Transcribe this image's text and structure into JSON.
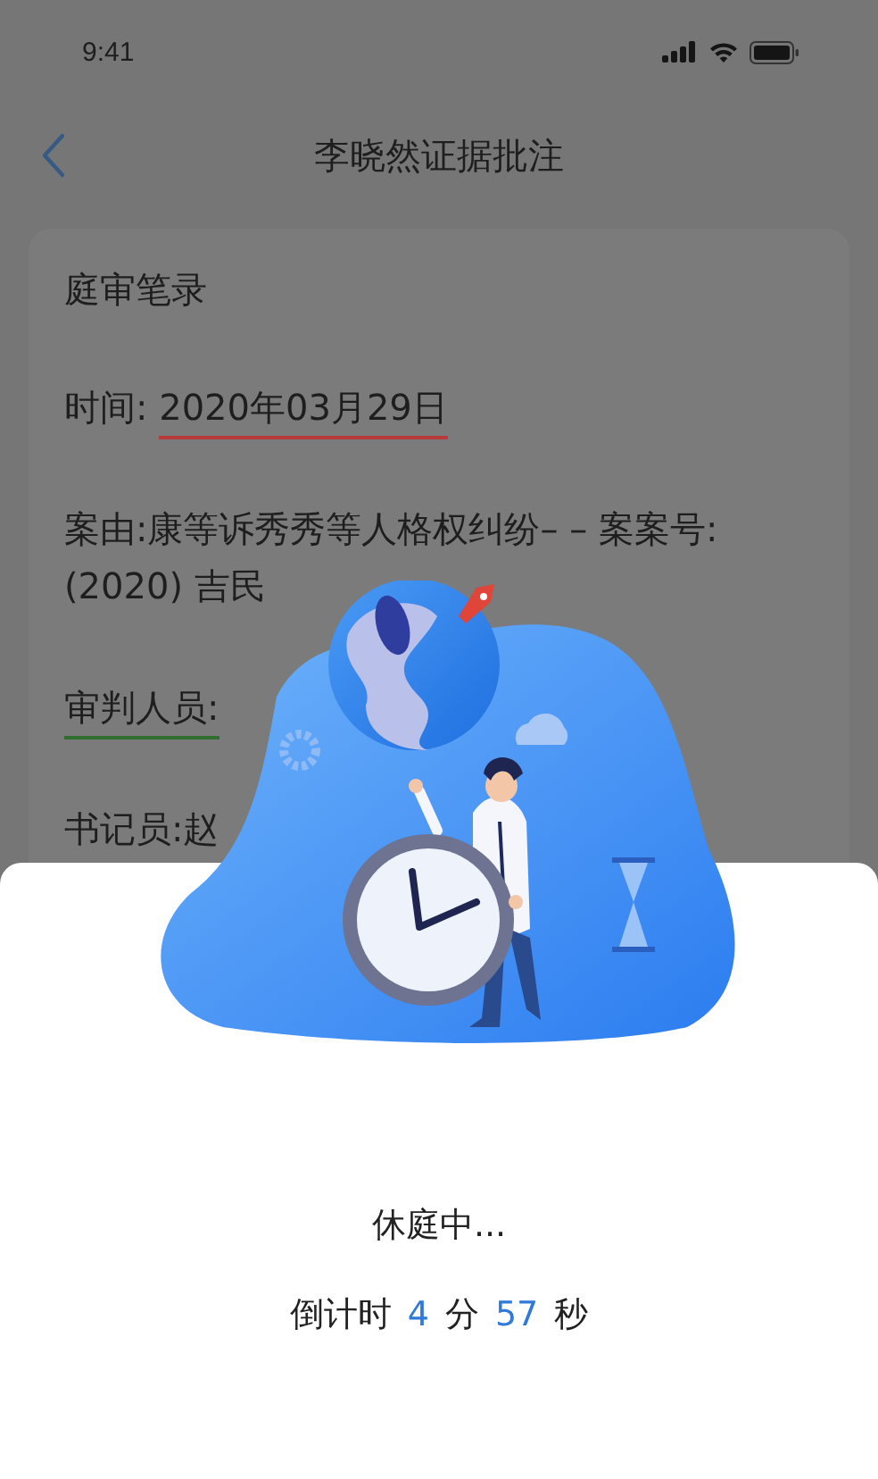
{
  "status_bar": {
    "time": "9:41"
  },
  "nav": {
    "title": "李晓然证据批注"
  },
  "record": {
    "lines": [
      {
        "text": "庭审笔录"
      },
      {
        "text": "时间: ",
        "marked": {
          "text": "2020年03月29日",
          "color": "#b83a3a"
        }
      },
      {
        "text": "案由:康等诉秀秀等人格权纠纷– – 案案号: (2020) 吉民"
      },
      {
        "marked": {
          "text": "审判人员:",
          "color": "#2f6e2f"
        }
      },
      {
        "text": "书记员:赵"
      }
    ]
  },
  "sheet": {
    "status": "休庭中...",
    "countdown": [
      {
        "text": "倒计时",
        "kind": "label"
      },
      {
        "text": "4",
        "kind": "number"
      },
      {
        "text": "分",
        "kind": "label"
      },
      {
        "text": "57",
        "kind": "number"
      },
      {
        "text": "秒",
        "kind": "label"
      }
    ]
  }
}
